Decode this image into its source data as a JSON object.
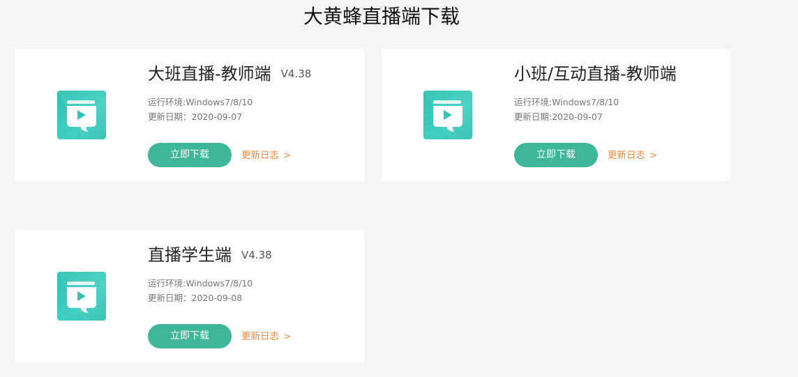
{
  "page": {
    "title": "大黄蜂直播端下载"
  },
  "colors": {
    "accent": "#3db699",
    "link": "#f08a3c",
    "icon": "#33c3b5"
  },
  "cards": [
    {
      "title": "大班直播-教师端",
      "version": "V4.38",
      "env": "运行环境:Windows7/8/10",
      "date": "更新日期：2020-09-07",
      "download_label": "立即下载",
      "log_label": "更新日志",
      "log_arrow": ">",
      "icon": "play-book-icon"
    },
    {
      "title": "小班/互动直播-教师端",
      "version": "",
      "env": "运行环境:Windows7/8/10",
      "date": "更新日期:2020-09-07",
      "download_label": "立即下载",
      "log_label": "更新日志",
      "log_arrow": ">",
      "icon": "play-book-icon"
    },
    {
      "title": "直播学生端",
      "version": "V4.38",
      "env": "运行环境:Windows7/8/10",
      "date": "更新日期：2020-09-08",
      "download_label": "立即下载",
      "log_label": "更新日志",
      "log_arrow": ">",
      "icon": "play-book-icon"
    }
  ]
}
